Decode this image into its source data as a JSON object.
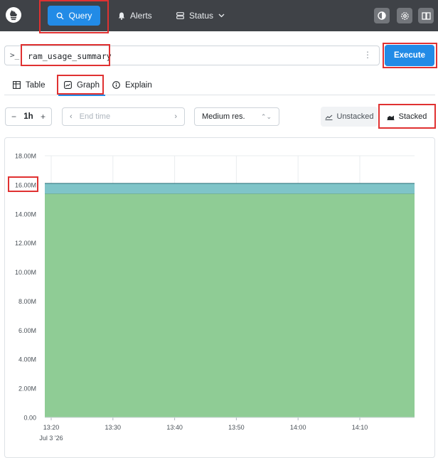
{
  "navbar": {
    "query_label": "Query",
    "alerts_label": "Alerts",
    "status_label": "Status",
    "icons": {
      "logo": "prometheus-logo-icon",
      "query": "search-icon",
      "alerts": "bell-icon",
      "status": "server-icon",
      "theme": "theme-toggle-icon",
      "settings": "gear-icon",
      "docs": "book-icon"
    }
  },
  "query": {
    "prompt": ">_",
    "expression": "ram_usage_summary",
    "execute_label": "Execute"
  },
  "tabs": [
    {
      "label": "Table",
      "icon": "table-icon"
    },
    {
      "label": "Graph",
      "icon": "graph-icon"
    },
    {
      "label": "Explain",
      "icon": "info-icon"
    }
  ],
  "controls": {
    "range_value": "1h",
    "end_time_placeholder": "End time",
    "resolution": "Medium res.",
    "unstacked_label": "Unstacked",
    "stacked_label": "Stacked"
  },
  "colors": {
    "accent": "#228be6",
    "navbar": "#3f4247",
    "series_green": "#8fcc95",
    "series_teal": "#7fc4c8"
  },
  "chart_data": {
    "type": "area",
    "stacked": true,
    "title": "",
    "xlabel": "",
    "ylabel": "",
    "x_ticks": [
      "13:20",
      "13:30",
      "13:40",
      "13:50",
      "14:00",
      "14:10"
    ],
    "x_tick_sublabel": "Jul 3 '26",
    "y_ticks": [
      "0.00",
      "2.00M",
      "4.00M",
      "6.00M",
      "8.00M",
      "10.00M",
      "12.00M",
      "14.00M",
      "16.00M",
      "18.00M"
    ],
    "ylim": [
      0,
      18000000
    ],
    "x_range_minutes": [
      0,
      60
    ],
    "series": [
      {
        "values": [
          15400000,
          15400000
        ],
        "x": [
          0,
          60
        ],
        "color": "#8fcc95"
      },
      {
        "values": [
          700000,
          700000
        ],
        "x": [
          0,
          60
        ],
        "color": "#7fc4c8"
      }
    ],
    "grid": true
  }
}
